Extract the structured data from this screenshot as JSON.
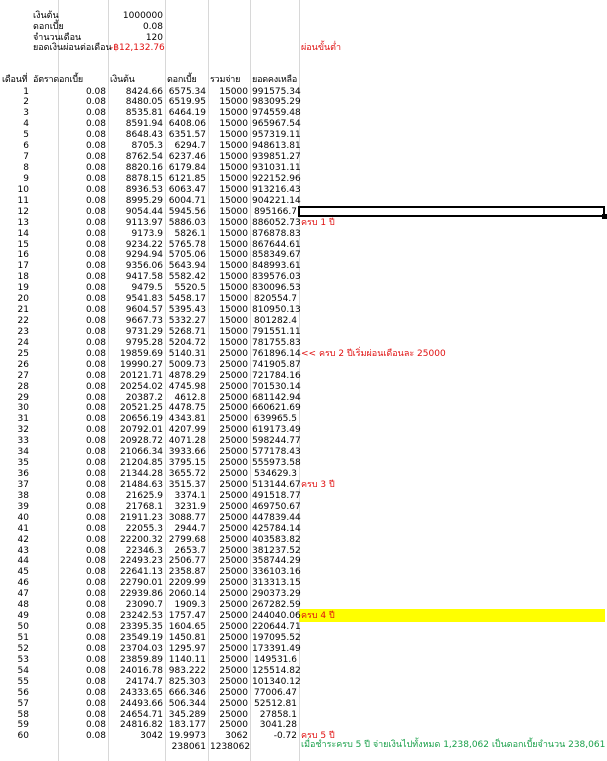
{
  "params": [
    {
      "label": "เงินต้น",
      "value": "1000000"
    },
    {
      "label": "ดอกเบี้ย",
      "value": "0.08"
    },
    {
      "label": "จำนวนเดือน",
      "value": "120"
    },
    {
      "label": "ยอดเงินผ่อนต่อเดือน",
      "value": "-฿12,132.76"
    }
  ],
  "min_note": "ผ่อนขั้นต่ำ",
  "headers": [
    "เดือนที่",
    "อัตราดอกเบี้ย",
    "เงินต้น",
    "ดอกเบี้ย",
    "รวมจ่าย",
    "ยอดคงเหลือ"
  ],
  "rows": [
    [
      "1",
      "0.08",
      "8424.66",
      "6575.34",
      "15000",
      "991575.34"
    ],
    [
      "2",
      "0.08",
      "8480.05",
      "6519.95",
      "15000",
      "983095.29"
    ],
    [
      "3",
      "0.08",
      "8535.81",
      "6464.19",
      "15000",
      "974559.48"
    ],
    [
      "4",
      "0.08",
      "8591.94",
      "6408.06",
      "15000",
      "965967.54"
    ],
    [
      "5",
      "0.08",
      "8648.43",
      "6351.57",
      "15000",
      "957319.11"
    ],
    [
      "6",
      "0.08",
      "8705.3",
      "6294.7",
      "15000",
      "948613.81"
    ],
    [
      "7",
      "0.08",
      "8762.54",
      "6237.46",
      "15000",
      "939851.27"
    ],
    [
      "8",
      "0.08",
      "8820.16",
      "6179.84",
      "15000",
      "931031.11"
    ],
    [
      "9",
      "0.08",
      "8878.15",
      "6121.85",
      "15000",
      "922152.96"
    ],
    [
      "10",
      "0.08",
      "8936.53",
      "6063.47",
      "15000",
      "913216.43"
    ],
    [
      "11",
      "0.08",
      "8995.29",
      "6004.71",
      "15000",
      "904221.14"
    ],
    [
      "12",
      "0.08",
      "9054.44",
      "5945.56",
      "15000",
      "895166.7"
    ],
    [
      "13",
      "0.08",
      "9113.97",
      "5886.03",
      "15000",
      "886052.73"
    ],
    [
      "14",
      "0.08",
      "9173.9",
      "5826.1",
      "15000",
      "876878.83"
    ],
    [
      "15",
      "0.08",
      "9234.22",
      "5765.78",
      "15000",
      "867644.61"
    ],
    [
      "16",
      "0.08",
      "9294.94",
      "5705.06",
      "15000",
      "858349.67"
    ],
    [
      "17",
      "0.08",
      "9356.06",
      "5643.94",
      "15000",
      "848993.61"
    ],
    [
      "18",
      "0.08",
      "9417.58",
      "5582.42",
      "15000",
      "839576.03"
    ],
    [
      "19",
      "0.08",
      "9479.5",
      "5520.5",
      "15000",
      "830096.53"
    ],
    [
      "20",
      "0.08",
      "9541.83",
      "5458.17",
      "15000",
      "820554.7"
    ],
    [
      "21",
      "0.08",
      "9604.57",
      "5395.43",
      "15000",
      "810950.13"
    ],
    [
      "22",
      "0.08",
      "9667.73",
      "5332.27",
      "15000",
      "801282.4"
    ],
    [
      "23",
      "0.08",
      "9731.29",
      "5268.71",
      "15000",
      "791551.11"
    ],
    [
      "24",
      "0.08",
      "9795.28",
      "5204.72",
      "15000",
      "781755.83"
    ],
    [
      "25",
      "0.08",
      "19859.69",
      "5140.31",
      "25000",
      "761896.14"
    ],
    [
      "26",
      "0.08",
      "19990.27",
      "5009.73",
      "25000",
      "741905.87"
    ],
    [
      "27",
      "0.08",
      "20121.71",
      "4878.29",
      "25000",
      "721784.16"
    ],
    [
      "28",
      "0.08",
      "20254.02",
      "4745.98",
      "25000",
      "701530.14"
    ],
    [
      "29",
      "0.08",
      "20387.2",
      "4612.8",
      "25000",
      "681142.94"
    ],
    [
      "30",
      "0.08",
      "20521.25",
      "4478.75",
      "25000",
      "660621.69"
    ],
    [
      "31",
      "0.08",
      "20656.19",
      "4343.81",
      "25000",
      "639965.5"
    ],
    [
      "32",
      "0.08",
      "20792.01",
      "4207.99",
      "25000",
      "619173.49"
    ],
    [
      "33",
      "0.08",
      "20928.72",
      "4071.28",
      "25000",
      "598244.77"
    ],
    [
      "34",
      "0.08",
      "21066.34",
      "3933.66",
      "25000",
      "577178.43"
    ],
    [
      "35",
      "0.08",
      "21204.85",
      "3795.15",
      "25000",
      "555973.58"
    ],
    [
      "36",
      "0.08",
      "21344.28",
      "3655.72",
      "25000",
      "534629.3"
    ],
    [
      "37",
      "0.08",
      "21484.63",
      "3515.37",
      "25000",
      "513144.67"
    ],
    [
      "38",
      "0.08",
      "21625.9",
      "3374.1",
      "25000",
      "491518.77"
    ],
    [
      "39",
      "0.08",
      "21768.1",
      "3231.9",
      "25000",
      "469750.67"
    ],
    [
      "40",
      "0.08",
      "21911.23",
      "3088.77",
      "25000",
      "447839.44"
    ],
    [
      "41",
      "0.08",
      "22055.3",
      "2944.7",
      "25000",
      "425784.14"
    ],
    [
      "42",
      "0.08",
      "22200.32",
      "2799.68",
      "25000",
      "403583.82"
    ],
    [
      "43",
      "0.08",
      "22346.3",
      "2653.7",
      "25000",
      "381237.52"
    ],
    [
      "44",
      "0.08",
      "22493.23",
      "2506.77",
      "25000",
      "358744.29"
    ],
    [
      "45",
      "0.08",
      "22641.13",
      "2358.87",
      "25000",
      "336103.16"
    ],
    [
      "46",
      "0.08",
      "22790.01",
      "2209.99",
      "25000",
      "313313.15"
    ],
    [
      "47",
      "0.08",
      "22939.86",
      "2060.14",
      "25000",
      "290373.29"
    ],
    [
      "48",
      "0.08",
      "23090.7",
      "1909.3",
      "25000",
      "267282.59"
    ],
    [
      "49",
      "0.08",
      "23242.53",
      "1757.47",
      "25000",
      "244040.06"
    ],
    [
      "50",
      "0.08",
      "23395.35",
      "1604.65",
      "25000",
      "220644.71"
    ],
    [
      "51",
      "0.08",
      "23549.19",
      "1450.81",
      "25000",
      "197095.52"
    ],
    [
      "52",
      "0.08",
      "23704.03",
      "1295.97",
      "25000",
      "173391.49"
    ],
    [
      "53",
      "0.08",
      "23859.89",
      "1140.11",
      "25000",
      "149531.6"
    ],
    [
      "54",
      "0.08",
      "24016.78",
      "983.222",
      "25000",
      "125514.82"
    ],
    [
      "55",
      "0.08",
      "24174.7",
      "825.303",
      "25000",
      "101340.12"
    ],
    [
      "56",
      "0.08",
      "24333.65",
      "666.346",
      "25000",
      "77006.47"
    ],
    [
      "57",
      "0.08",
      "24493.66",
      "506.344",
      "25000",
      "52512.81"
    ],
    [
      "58",
      "0.08",
      "24654.71",
      "345.289",
      "25000",
      "27858.1"
    ],
    [
      "59",
      "0.08",
      "24816.82",
      "183.177",
      "25000",
      "3041.28"
    ],
    [
      "60",
      "0.08",
      "3042",
      "19.9973",
      "3062",
      "-0.72"
    ]
  ],
  "totals": {
    "interest": "238061",
    "paid": "1238062"
  },
  "notes": [
    {
      "row": 13,
      "text": "ครบ 1 ปี",
      "color": "red"
    },
    {
      "row": 25,
      "text": "<< ครบ 2 ปีเริ่มผ่อนเดือนละ 25000",
      "color": "red"
    },
    {
      "row": 37,
      "text": "ครบ 3 ปี",
      "color": "red"
    },
    {
      "row": 49,
      "text": "ครบ 4 ปี",
      "color": "red"
    },
    {
      "row": 60,
      "text": "ครบ 5 ปี",
      "color": "red"
    }
  ],
  "summary": "เมื่อชำระครบ 5 ปี จ่ายเงินไปทั้งหมด 1,238,062 เป็นดอกเบี้ยจำนวน 238,061",
  "highlight_row": 49,
  "selected_row": 12,
  "colors": {
    "red": "#e01010",
    "green": "#1aa04a",
    "highlight": "#ffff00",
    "grid": "#d8d8d8"
  }
}
